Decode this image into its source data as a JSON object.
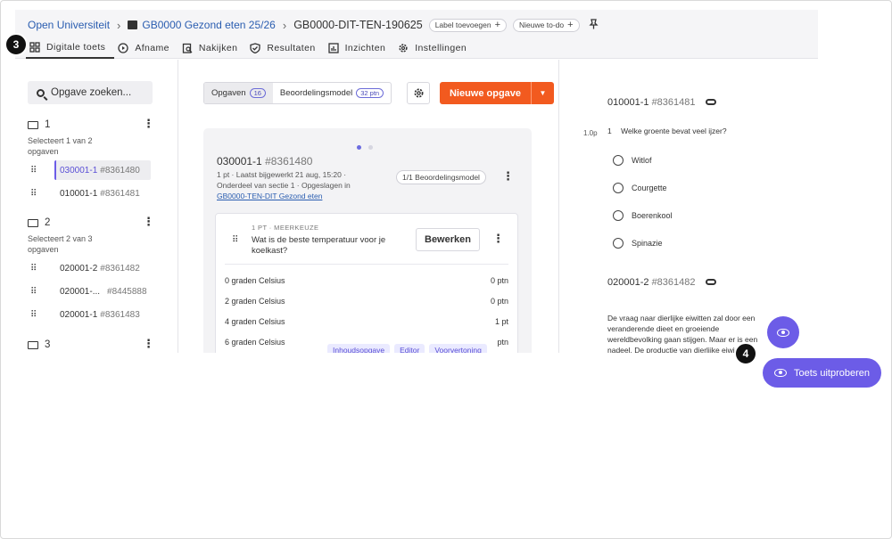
{
  "breadcrumb": {
    "items": [
      "Open Universiteit",
      "GB0000 Gezond eten 25/26"
    ],
    "current": "GB0000-DIT-TEN-190625",
    "label_add": "Label toevoegen",
    "todo_add": "Nieuwe to-do"
  },
  "tabs": [
    "Digitale toets",
    "Afname",
    "Nakijken",
    "Resultaten",
    "Inzichten",
    "Instellingen"
  ],
  "left": {
    "search_placeholder": "Opgave zoeken...",
    "sections": [
      {
        "num": "1",
        "sub": "Selecteert 1 van 2 opgaven",
        "items": [
          {
            "code": "030001-1",
            "hash": "#8361480"
          },
          {
            "code": "010001-1",
            "hash": "#8361481"
          }
        ]
      },
      {
        "num": "2",
        "sub": "Selecteert 2 van 3 opgaven",
        "items": [
          {
            "code": "020001-2",
            "hash": "#8361482"
          },
          {
            "code": "020001-...",
            "hash": "#8445888"
          },
          {
            "code": "020001-1",
            "hash": "#8361483"
          }
        ]
      },
      {
        "num": "3"
      }
    ]
  },
  "middle": {
    "seg_opgaven": "Opgaven",
    "seg_opgaven_count": "16",
    "seg_beoordeling": "Beoordelingsmodel",
    "seg_beoordeling_count": "32 ptn",
    "new_button": "Nieuwe opgave",
    "card": {
      "code": "030001-1",
      "hash": "#8361480",
      "meta": "1 pt · Laatst bijgewerkt 21 aug, 15:20 · Onderdeel van sectie 1 · Opgeslagen in",
      "meta_link": "GB0000-TEN-DIT Gezond eten",
      "model_pill": "1/1 Beoordelingsmodel",
      "q_type": "1 PT · MEERKEUZE",
      "q_text": "Wat is de beste temperatuur voor je koelkast?",
      "edit_button": "Bewerken",
      "options": [
        {
          "label": "0 graden Celsius",
          "pts": "0 ptn"
        },
        {
          "label": "2 graden Celsius",
          "pts": "0 ptn"
        },
        {
          "label": "4 graden Celsius",
          "pts": "1 pt"
        },
        {
          "label": "6 graden Celsius",
          "pts": "ptn"
        }
      ],
      "chips": [
        "Inhoudsopgave",
        "Editor",
        "Voorvertoning"
      ]
    }
  },
  "right": {
    "q1": {
      "code": "010001-1",
      "hash": "#8361481",
      "points": "1.0p",
      "num": "1",
      "text": "Welke groente bevat veel ijzer?",
      "options": [
        "Witlof",
        "Courgette",
        "Boerenkool",
        "Spinazie"
      ]
    },
    "q2": {
      "code": "020001-2",
      "hash": "#8361482",
      "text": "De vraag naar dierlijke eiwitten zal door een veranderende dieet en groeiende wereldbevolking gaan stijgen. Maar er is een nadeel. De productie van dierlijke eiwitten"
    }
  },
  "badges": {
    "tabs": "3",
    "try": "4"
  },
  "try_button": "Toets uitproberen",
  "colors": {
    "accent": "#6c5ce7",
    "orange": "#f25a1f",
    "link": "#2a5db0"
  }
}
